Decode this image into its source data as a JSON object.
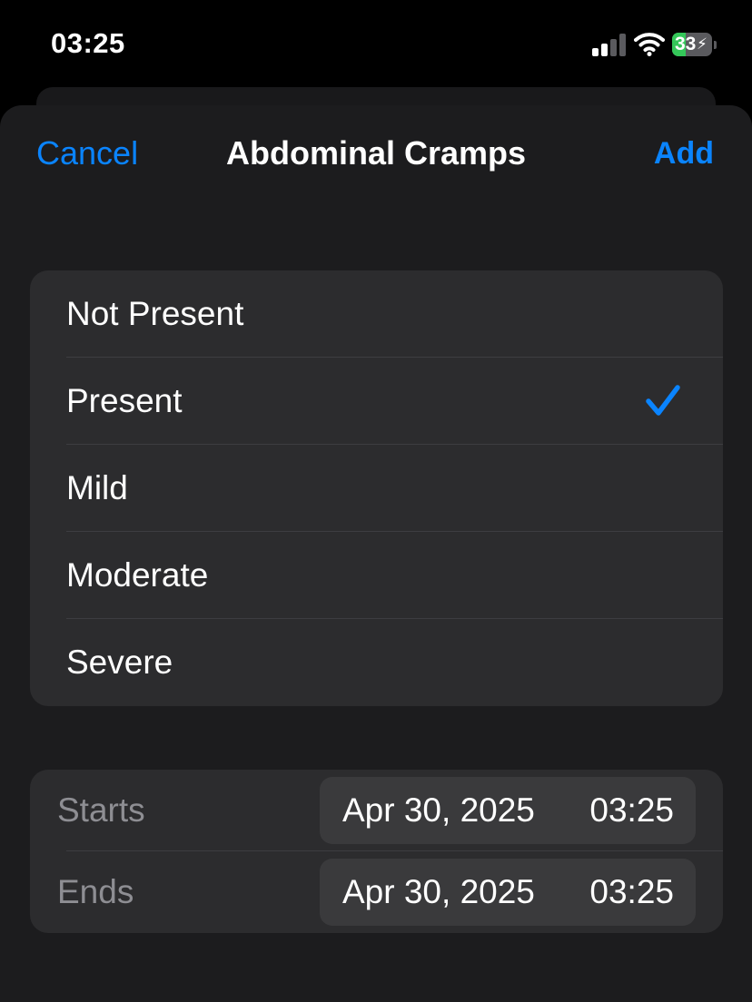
{
  "status_bar": {
    "time": "03:25",
    "battery_level": "33",
    "battery_charging": true,
    "signal_bars": 2,
    "icons": [
      "cellular-signal-icon",
      "wifi-icon",
      "battery-icon"
    ]
  },
  "nav": {
    "cancel_label": "Cancel",
    "title": "Abdominal Cramps",
    "add_label": "Add"
  },
  "options": [
    {
      "label": "Not Present",
      "selected": false
    },
    {
      "label": "Present",
      "selected": true
    },
    {
      "label": "Mild",
      "selected": false
    },
    {
      "label": "Moderate",
      "selected": false
    },
    {
      "label": "Severe",
      "selected": false
    }
  ],
  "dates": {
    "starts": {
      "label": "Starts",
      "date": "Apr 30, 2025",
      "time": "03:25"
    },
    "ends": {
      "label": "Ends",
      "date": "Apr 30, 2025",
      "time": "03:25"
    }
  },
  "colors": {
    "accent": "#0a84ff",
    "background": "#000000",
    "sheet": "#1c1c1e",
    "group": "#2c2c2e",
    "pill": "#3a3a3c",
    "secondary_text": "#8e8e93",
    "battery_green": "#34c759"
  }
}
